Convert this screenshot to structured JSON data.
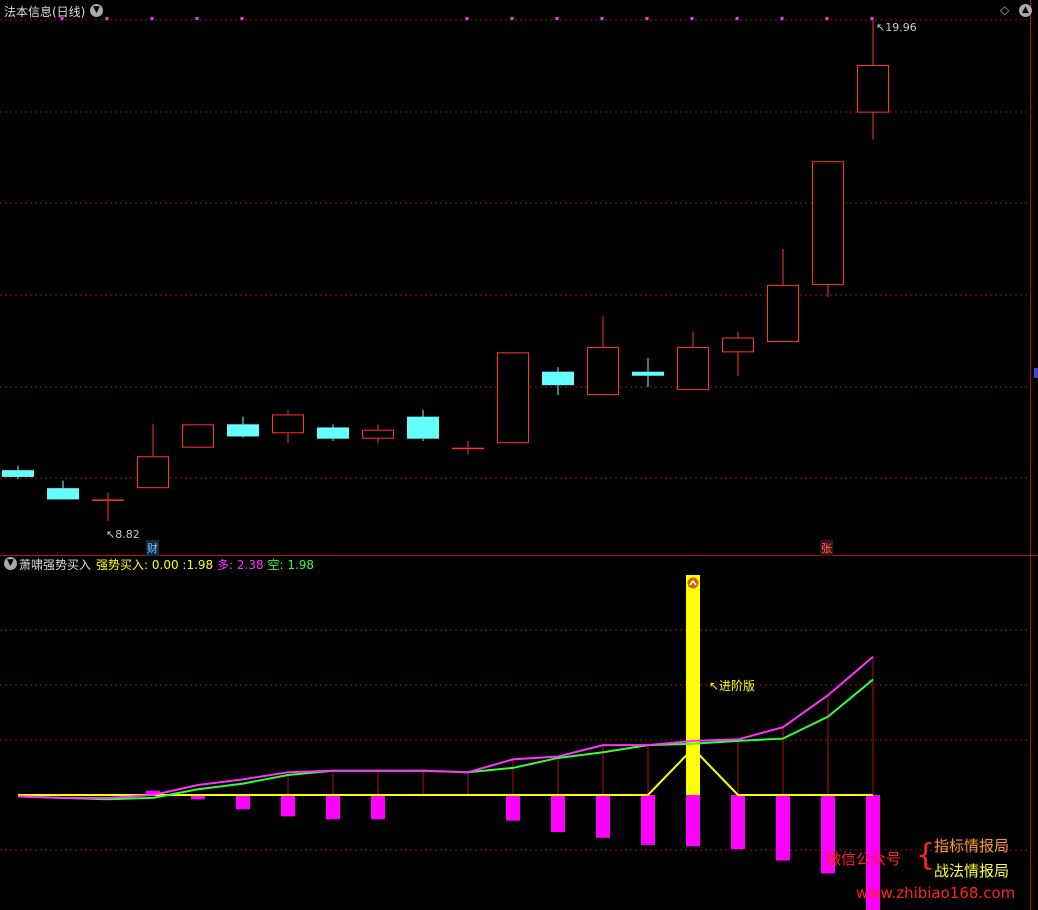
{
  "upper": {
    "title": "法本信息(日线)",
    "high_label": "19.96",
    "low_label": "8.82",
    "markers": {
      "cai": "财",
      "zhang": "张"
    }
  },
  "lower": {
    "title": "萧啸强势买入",
    "legend": [
      {
        "label": "强势买入:",
        "value": "0.00",
        "color": "#ffff00"
      },
      {
        "label": ":",
        "value": "1.98",
        "color": "#ffff00"
      },
      {
        "label": "多:",
        "value": "2.38",
        "color": "#ff33ff"
      },
      {
        "label": "空:",
        "value": "1.98",
        "color": "#33ff33"
      }
    ],
    "annotation": "进阶版"
  },
  "watermark": {
    "left": "微信公众号",
    "right_top": "指标情报局",
    "right_bottom": "战法情报局",
    "url": "www.zhibiao168.com"
  },
  "colors": {
    "up": "#ff3333",
    "down": "#66ffff",
    "grid": "#a01010",
    "buy": "#ffff00",
    "duo": "#ff33ff",
    "kong": "#33ff33"
  },
  "chart_data": [
    {
      "type": "candlestick",
      "title": "法本信息(日线)",
      "ohlc": [
        {
          "o": 9.95,
          "h": 10.05,
          "l": 9.75,
          "c": 9.8
        },
        {
          "o": 9.55,
          "h": 9.72,
          "l": 9.3,
          "c": 9.3
        },
        {
          "o": 9.3,
          "h": 9.45,
          "l": 8.82,
          "c": 9.3
        },
        {
          "o": 9.55,
          "h": 10.97,
          "l": 9.55,
          "c": 10.26
        },
        {
          "o": 10.45,
          "h": 10.97,
          "l": 10.45,
          "c": 10.97
        },
        {
          "o": 10.97,
          "h": 11.14,
          "l": 10.68,
          "c": 10.7
        },
        {
          "o": 10.77,
          "h": 11.29,
          "l": 10.55,
          "c": 11.19
        },
        {
          "o": 10.9,
          "h": 10.97,
          "l": 10.6,
          "c": 10.65
        },
        {
          "o": 10.65,
          "h": 10.97,
          "l": 10.55,
          "c": 10.85
        },
        {
          "o": 11.14,
          "h": 11.29,
          "l": 10.6,
          "c": 10.65
        },
        {
          "o": 10.45,
          "h": 10.6,
          "l": 10.3,
          "c": 10.45
        },
        {
          "o": 10.55,
          "h": 12.57,
          "l": 10.55,
          "c": 12.57
        },
        {
          "o": 12.14,
          "h": 12.24,
          "l": 11.62,
          "c": 11.84
        },
        {
          "o": 11.62,
          "h": 13.37,
          "l": 11.62,
          "c": 12.69
        },
        {
          "o": 12.14,
          "h": 12.45,
          "l": 11.8,
          "c": 12.05
        },
        {
          "o": 11.73,
          "h": 13.03,
          "l": 11.73,
          "c": 12.69
        },
        {
          "o": 12.57,
          "h": 13.03,
          "l": 12.05,
          "c": 12.9
        },
        {
          "o": 12.8,
          "h": 14.87,
          "l": 12.8,
          "c": 14.07
        },
        {
          "o": 14.07,
          "h": 16.82,
          "l": 13.8,
          "c": 16.82
        },
        {
          "o": 17.9,
          "h": 19.96,
          "l": 17.3,
          "c": 18.96
        }
      ],
      "high_marker": 19.96,
      "low_marker": 8.82
    },
    {
      "type": "indicator",
      "title": "萧啸强势买入",
      "series": [
        {
          "name": "多",
          "color": "#ff33ff",
          "values": [
            -0.05,
            -0.1,
            -0.1,
            0.0,
            0.35,
            0.55,
            0.8,
            0.85,
            0.85,
            0.85,
            0.8,
            1.25,
            1.35,
            1.75,
            1.75,
            1.9,
            1.95,
            2.38,
            3.5,
            4.85
          ]
        },
        {
          "name": "空",
          "color": "#33ff33",
          "values": [
            -0.05,
            -0.1,
            -0.15,
            -0.1,
            0.2,
            0.4,
            0.7,
            0.85,
            0.85,
            0.85,
            0.8,
            0.95,
            1.3,
            1.5,
            1.75,
            1.8,
            1.9,
            1.98,
            2.75,
            4.05
          ]
        },
        {
          "name": "强势买入",
          "color": "#ffff00",
          "values": [
            0,
            0,
            0,
            0,
            0,
            0,
            0,
            0,
            0,
            0,
            0,
            0,
            0,
            0,
            0,
            1.98,
            0,
            0,
            0,
            0
          ]
        }
      ],
      "bars": [
        0.0,
        0.0,
        0.0,
        0.15,
        -0.15,
        -0.5,
        -0.75,
        -0.85,
        -0.85,
        0.0,
        0.0,
        -0.9,
        -1.3,
        -1.5,
        -1.75,
        -1.8,
        -1.9,
        -2.3,
        -2.75,
        -4.05
      ],
      "signal_index": 15
    }
  ]
}
